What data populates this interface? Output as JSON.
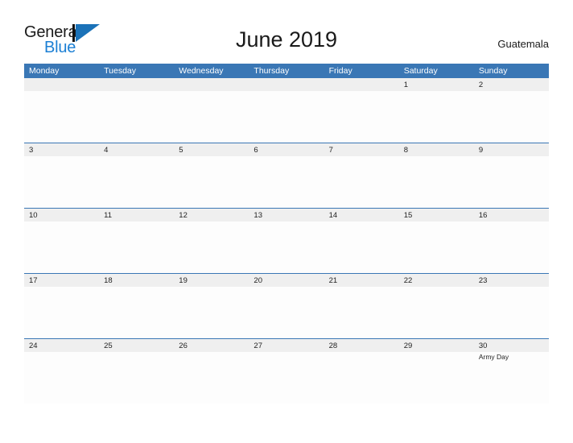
{
  "logo": {
    "word1": "General",
    "word2": "Blue",
    "flag_icon": "flag-triangle-icon",
    "brand_blue": "#1b72b8",
    "text_blue": "#1b7fd4"
  },
  "header": {
    "title": "June 2019",
    "country": "Guatemala"
  },
  "colors": {
    "header_blue": "#3a77b5",
    "date_strip_gray": "#efefef",
    "cell_white": "#fdfdfd",
    "text_dark": "#1f1f1f",
    "header_text": "#ffffff"
  },
  "calendar": {
    "month": "June",
    "year": "2019",
    "weekdays": [
      "Monday",
      "Tuesday",
      "Wednesday",
      "Thursday",
      "Friday",
      "Saturday",
      "Sunday"
    ],
    "weeks": [
      [
        {
          "day": "",
          "events": []
        },
        {
          "day": "",
          "events": []
        },
        {
          "day": "",
          "events": []
        },
        {
          "day": "",
          "events": []
        },
        {
          "day": "",
          "events": []
        },
        {
          "day": "1",
          "events": []
        },
        {
          "day": "2",
          "events": []
        }
      ],
      [
        {
          "day": "3",
          "events": []
        },
        {
          "day": "4",
          "events": []
        },
        {
          "day": "5",
          "events": []
        },
        {
          "day": "6",
          "events": []
        },
        {
          "day": "7",
          "events": []
        },
        {
          "day": "8",
          "events": []
        },
        {
          "day": "9",
          "events": []
        }
      ],
      [
        {
          "day": "10",
          "events": []
        },
        {
          "day": "11",
          "events": []
        },
        {
          "day": "12",
          "events": []
        },
        {
          "day": "13",
          "events": []
        },
        {
          "day": "14",
          "events": []
        },
        {
          "day": "15",
          "events": []
        },
        {
          "day": "16",
          "events": []
        }
      ],
      [
        {
          "day": "17",
          "events": []
        },
        {
          "day": "18",
          "events": []
        },
        {
          "day": "19",
          "events": []
        },
        {
          "day": "20",
          "events": []
        },
        {
          "day": "21",
          "events": []
        },
        {
          "day": "22",
          "events": []
        },
        {
          "day": "23",
          "events": []
        }
      ],
      [
        {
          "day": "24",
          "events": []
        },
        {
          "day": "25",
          "events": []
        },
        {
          "day": "26",
          "events": []
        },
        {
          "day": "27",
          "events": []
        },
        {
          "day": "28",
          "events": []
        },
        {
          "day": "29",
          "events": []
        },
        {
          "day": "30",
          "events": [
            "Army Day"
          ]
        }
      ]
    ]
  }
}
